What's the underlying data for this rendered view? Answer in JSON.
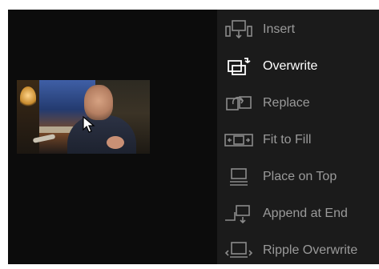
{
  "edit_overlay": {
    "items": [
      {
        "label": "Insert",
        "icon": "insert-icon",
        "active": false
      },
      {
        "label": "Overwrite",
        "icon": "overwrite-icon",
        "active": true
      },
      {
        "label": "Replace",
        "icon": "replace-icon",
        "active": false
      },
      {
        "label": "Fit to Fill",
        "icon": "fit-to-fill-icon",
        "active": false
      },
      {
        "label": "Place on Top",
        "icon": "place-on-top-icon",
        "active": false
      },
      {
        "label": "Append at End",
        "icon": "append-at-end-icon",
        "active": false
      },
      {
        "label": "Ripple Overwrite",
        "icon": "ripple-overwrite-icon",
        "active": false
      }
    ]
  },
  "colors": {
    "viewer_background": "#0c0c0c",
    "menu_background": "#1b1b1b",
    "label_inactive": "#9a9a9a",
    "label_active": "#ffffff"
  }
}
